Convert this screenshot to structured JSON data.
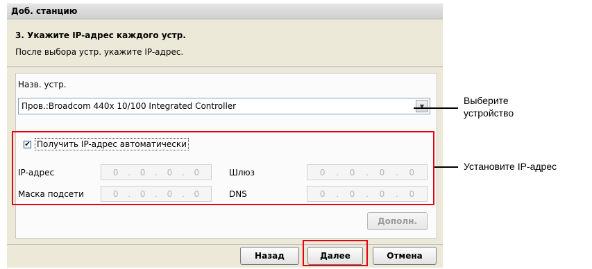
{
  "window": {
    "title": "Доб. станцию"
  },
  "header": {
    "step_title": "3. Укажите IP-адрес каждого устр.",
    "step_desc": "После выбора устр. укажите IP-адрес."
  },
  "device": {
    "label": "Назв. устр.",
    "selected": "Пров.:Broadcom 440x 10/100 Integrated Controller"
  },
  "ip_settings": {
    "auto_checkbox_label": "Получить IP-адрес автоматически",
    "auto_checked": true,
    "check_glyph": "✔",
    "ip_label": "IP-адрес",
    "gateway_label": "Шлюз",
    "mask_label": "Маска подсети",
    "dns_label": "DNS",
    "ip_value": [
      "0",
      ".",
      "0",
      ".",
      "0",
      ".",
      "0"
    ],
    "gateway_value": [
      "0",
      ".",
      "0",
      ".",
      "0",
      ".",
      "0"
    ],
    "mask_value": [
      "0",
      ".",
      "0",
      ".",
      "0",
      ".",
      "0"
    ],
    "dns_value": [
      "0",
      ".",
      "0",
      ".",
      "0",
      ".",
      "0"
    ]
  },
  "buttons": {
    "advanced": "Дополн.",
    "back": "Назад",
    "next": "Далее",
    "cancel": "Отмена"
  },
  "callouts": {
    "select_device_line1": "Выберите",
    "select_device_line2": "устройство",
    "set_ip": "Установите IP-адрес"
  },
  "colors": {
    "highlight": "#e60012",
    "window_bg": "#ece9d8"
  }
}
